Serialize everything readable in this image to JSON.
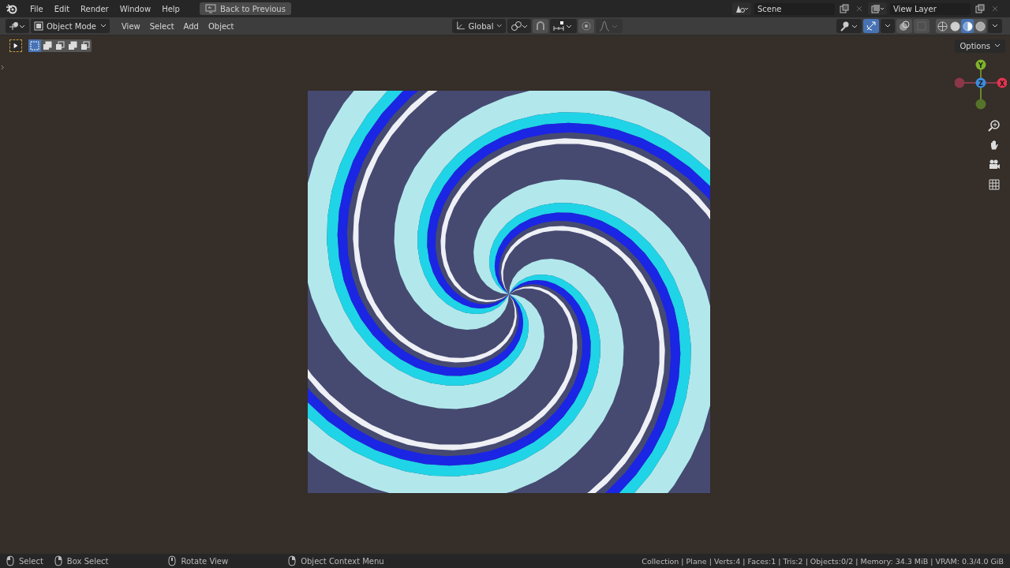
{
  "menu_bar": {
    "items": [
      "File",
      "Edit",
      "Render",
      "Window",
      "Help"
    ],
    "back_button": "Back to Previous",
    "scene": "Scene",
    "view_layer": "View Layer"
  },
  "header": {
    "mode": "Object Mode",
    "menus": [
      "View",
      "Select",
      "Add",
      "Object"
    ],
    "orientation": "Global",
    "snap_on": false,
    "proportional_on": false,
    "gizmos_on": true,
    "xray_on": false,
    "shading": [
      {
        "selected": false
      },
      {
        "selected": false
      },
      {
        "selected": true
      },
      {
        "selected": false
      }
    ],
    "options": "Options"
  },
  "select_modes": [
    {
      "selected": true
    },
    {
      "selected": false
    },
    {
      "selected": false
    },
    {
      "selected": false
    },
    {
      "selected": false
    }
  ],
  "viewport": {
    "axes": [
      "Y",
      "Z",
      "X"
    ]
  },
  "status_bar": {
    "hints": [
      "Select",
      "Box Select",
      "Rotate View",
      "Object Context Menu"
    ],
    "stats": "Collection | Plane | Verts:4 | Faces:1 | Tris:2 | Objects:0/2 | Memory: 34.3 MiB | VRAM: 0.3/4.0 GiB"
  }
}
